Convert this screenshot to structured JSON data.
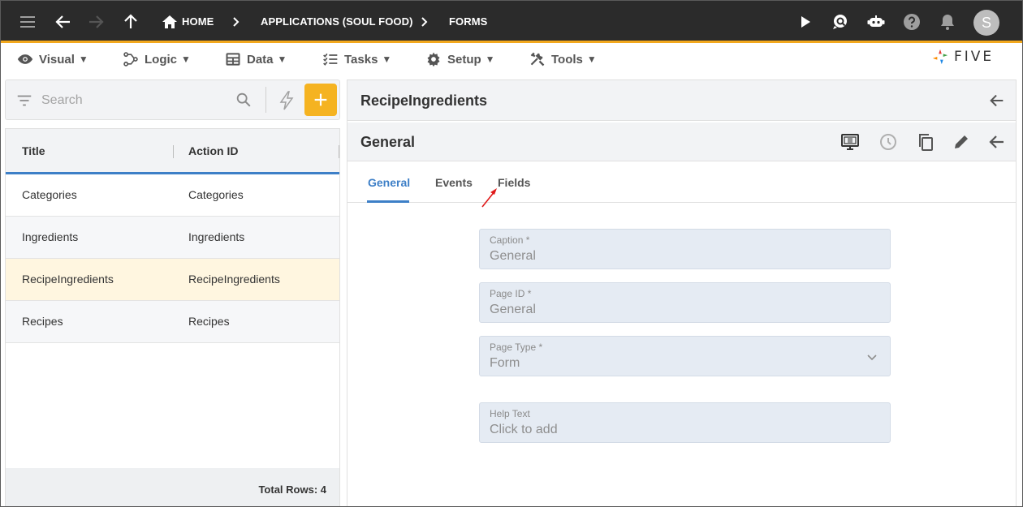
{
  "topbar": {
    "breadcrumbs": [
      "HOME",
      "APPLICATIONS (SOUL FOOD)",
      "FORMS"
    ],
    "avatar_letter": "S",
    "accent_color": "#f2a81d"
  },
  "menubar": {
    "items": [
      {
        "label": "Visual",
        "icon": "eye-icon"
      },
      {
        "label": "Logic",
        "icon": "logic-icon"
      },
      {
        "label": "Data",
        "icon": "table-icon"
      },
      {
        "label": "Tasks",
        "icon": "tasks-icon"
      },
      {
        "label": "Setup",
        "icon": "gear-icon"
      },
      {
        "label": "Tools",
        "icon": "tools-icon"
      }
    ],
    "logo_text": "FIVE"
  },
  "search": {
    "placeholder": "Search"
  },
  "list": {
    "columns": [
      "Title",
      "Action ID"
    ],
    "rows": [
      {
        "title": "Categories",
        "action_id": "Categories"
      },
      {
        "title": "Ingredients",
        "action_id": "Ingredients"
      },
      {
        "title": "RecipeIngredients",
        "action_id": "RecipeIngredients"
      },
      {
        "title": "Recipes",
        "action_id": "Recipes"
      }
    ],
    "selected_index": 2,
    "footer": "Total Rows: 4"
  },
  "detail": {
    "title": "RecipeIngredients",
    "form_title": "General",
    "tabs": [
      "General",
      "Events",
      "Fields"
    ],
    "active_tab": "General",
    "fields": [
      {
        "label": "Caption *",
        "value": "General"
      },
      {
        "label": "Page ID *",
        "value": "General"
      },
      {
        "label": "Page Type *",
        "value": "Form"
      },
      {
        "label": "Help Text",
        "value": "Click to add"
      }
    ]
  },
  "colors": {
    "primary": "#3d7fc7",
    "add_button": "#f5b321",
    "selected_row": "#fff6e0",
    "field_bg": "#e5ebf3"
  }
}
